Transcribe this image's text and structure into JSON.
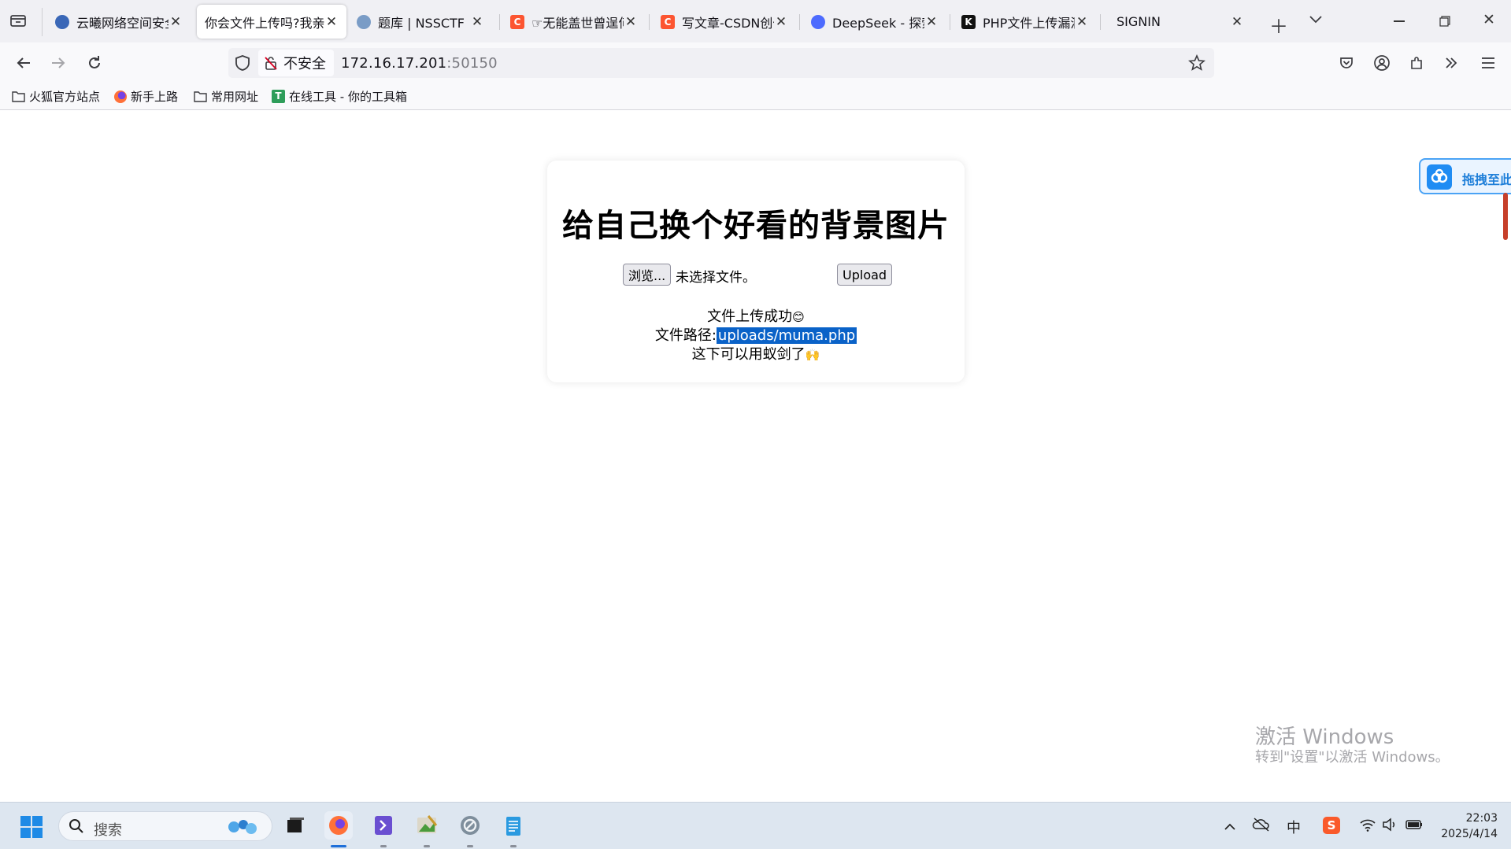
{
  "browser": {
    "tabs": [
      {
        "title": "云曦网络空间安全",
        "favicon_color": "#3a67b7"
      },
      {
        "title": "你会文件上传吗?我亲",
        "favicon_color": "none",
        "active": true
      },
      {
        "title": "题库 | NSSCTF",
        "favicon_color": "#7a9cc6"
      },
      {
        "title": "☞无能盖世曾逞何",
        "favicon_color": "#fc5531",
        "favicon_letter": "C"
      },
      {
        "title": "写文章-CSDN创作",
        "favicon_color": "#fc5531",
        "favicon_letter": "C"
      },
      {
        "title": "DeepSeek - 探索",
        "favicon_color": "#4d6bfe"
      },
      {
        "title": "PHP文件上传漏洞",
        "favicon_color": "#111111",
        "favicon_letter": "K"
      },
      {
        "title": "SIGNIN",
        "favicon_color": "none"
      }
    ],
    "address": {
      "security_label": "不安全",
      "host": "172.16.17.201",
      "port": ":50150"
    },
    "bookmarks": [
      {
        "label": "火狐官方站点",
        "icon": "folder-icon"
      },
      {
        "label": "新手上路",
        "icon": "firefox-icon"
      },
      {
        "label": "常用网址",
        "icon": "folder-icon"
      },
      {
        "label": "在线工具 - 你的工具箱",
        "icon": "toolbox-icon"
      }
    ]
  },
  "page": {
    "heading": "给自己换个好看的背景图片",
    "browse_button": "浏览...",
    "no_file_text": "未选择文件。",
    "upload_button": "Upload",
    "result": {
      "line1": "文件上传成功",
      "line2_prefix": "文件路径:",
      "line2_path": "uploads/muma.php",
      "line3": "这下可以用蚁剑了"
    },
    "emoji1": "😊",
    "emoji2": "🙌"
  },
  "widget": {
    "label": "拖拽至此"
  },
  "watermark": {
    "title": "激活 Windows",
    "subtitle": "转到\"设置\"以激活 Windows。"
  },
  "taskbar": {
    "search_placeholder": "搜索",
    "clock_time": "22:03",
    "clock_date": "2025/4/14",
    "ime": "中"
  }
}
